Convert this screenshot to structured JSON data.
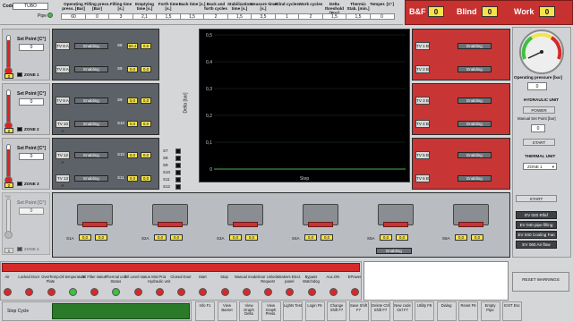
{
  "header": {
    "code_label": "Code",
    "code_value": "TUBO",
    "pipe_label": "Pipe",
    "fields": [
      {
        "label": "Operating press. [Bar]",
        "value": "60"
      },
      {
        "label": "Filling press. [Bar]",
        "value": "0"
      },
      {
        "label": "Filling time [s.]",
        "value": "3"
      },
      {
        "label": "Emptying time [s.]",
        "value": "2,1"
      },
      {
        "label": "Forth time [s.]",
        "value": "1,5"
      },
      {
        "label": "Back time [s.]",
        "value": "1,5"
      },
      {
        "label": "Back and forth cycles",
        "value": "2"
      },
      {
        "label": "Stabilization time [s.]",
        "value": "1,5"
      },
      {
        "label": "Measure time [s.]",
        "value": "3,5"
      },
      {
        "label": "Blind cycles",
        "value": "1"
      },
      {
        "label": "Work cycles",
        "value": "2"
      },
      {
        "label": "Delta threshold [Bar]",
        "value": "1,5"
      },
      {
        "label": "Thermic Stab. [min.]",
        "value": "1,5"
      },
      {
        "label": "Temper. [C°]",
        "value": "0"
      }
    ],
    "counters": [
      {
        "label": "B&F",
        "value": "0"
      },
      {
        "label": "Blind",
        "value": "0"
      },
      {
        "label": "Work",
        "value": "0"
      }
    ]
  },
  "zones": [
    {
      "label": "ZONE 1",
      "setpoint_label": "Set Point [C°]",
      "setpoint": "0",
      "readout": "0"
    },
    {
      "label": "ZONE 2",
      "setpoint_label": "Set Point [C°]",
      "setpoint": "0",
      "readout": "0"
    },
    {
      "label": "ZONE 3",
      "setpoint_label": "Set Point [C°]",
      "setpoint": "0",
      "readout": "0"
    },
    {
      "label": "ZONE 4",
      "setpoint_label": "Set Point [C°]",
      "setpoint": "0",
      "readout": "0"
    }
  ],
  "thermo_top_label": "T60",
  "left_panels": [
    {
      "tv_a": "TV 8 A",
      "tv_b": "TV 8 A",
      "s_a": "S8",
      "s_b": "S9",
      "val_a1": "60,4",
      "val_a2": "0,0",
      "val_b1": "0,0",
      "val_b2": "0,0",
      "enabling": "Enabling"
    },
    {
      "tv_a": "TV 9 A",
      "tv_b": "TV 10 A",
      "s_a": "S9",
      "s_b": "S10",
      "val_a1": "0,0",
      "val_a2": "0,0",
      "val_b1": "0,0",
      "val_b2": "0,0",
      "enabling": "Enabling"
    },
    {
      "tv_a": "TV 12 A",
      "tv_b": "TV 13 A",
      "s_a": "S10",
      "s_b": "S11",
      "val_a1": "0,0",
      "val_a2": "0,0",
      "val_b1": "0,0",
      "val_b2": "0,0",
      "enabling": "Enabling"
    }
  ],
  "right_panels": [
    {
      "tv_a": "TV 1 B",
      "tv_b": "TV 2 B",
      "enabling": "Enabling"
    },
    {
      "tv_a": "TV 3 B",
      "tv_b": "TV 4 B",
      "enabling": "Enabling"
    },
    {
      "tv_a": "TV 5 B",
      "tv_b": "TV 6 B",
      "enabling": "Enabling"
    }
  ],
  "sensor_list": [
    "S7",
    "S8",
    "S9",
    "S10",
    "S11",
    "S12"
  ],
  "chart": {
    "ylabel": "Delta [bar]",
    "xlabel": "Step",
    "yticks": [
      "0,5",
      "0,4",
      "0,3",
      "0,2",
      "0,1",
      "0"
    ]
  },
  "bottom_panel": {
    "stations": [
      "S1A",
      "S2A",
      "S3A",
      "S4A",
      "S5A",
      "S6A"
    ],
    "values": [
      "0,0",
      "0,0",
      "0,0",
      "0,0",
      "0,0",
      "0,0"
    ],
    "enabling": "Enabling"
  },
  "right_sidebar": {
    "gauge_label": "Operating pressure [bar]",
    "gauge_value": "0",
    "hydraulic_title": "HYDRAULIC UNIT",
    "power_label": "POWER",
    "manual_sp_label": "Manual Set Point [bar]",
    "manual_sp_value": "0",
    "start_label": "START",
    "thermal_title": "THERMAL UNIT",
    "zone_select": "ZONE 1",
    "start2_label": "START",
    "ev_buttons": [
      "EV 020 Rifaf",
      "EV 040 pipe filling",
      "EV 040 Cooling Fan",
      "EV 060 Air flow"
    ]
  },
  "alarms": [
    {
      "label": "Air",
      "color": "red"
    },
    {
      "label": "Locked Door",
      "color": "red"
    },
    {
      "label": "OverTemp. Plate",
      "color": "red"
    },
    {
      "label": "Oil temperature",
      "color": "green"
    },
    {
      "label": "Oil Filter status",
      "color": "red"
    },
    {
      "label": "Thermal unit Status",
      "color": "green"
    },
    {
      "label": "Oil Level status",
      "color": "red"
    },
    {
      "label": "Mot.Prot. Hydraulic unit",
      "color": "red"
    },
    {
      "label": "Closed Door",
      "color": "red"
    },
    {
      "label": "Start",
      "color": "red"
    },
    {
      "label": "Stop",
      "color": "red"
    },
    {
      "label": "Manual mode",
      "color": "red"
    },
    {
      "label": "Door Unlock Request",
      "color": "red"
    },
    {
      "label": "Brakers Elect. panel",
      "color": "red"
    },
    {
      "label": "Bypass Watchdog",
      "color": "red"
    },
    {
      "label": "Aux.ON",
      "color": "red"
    },
    {
      "label": "EPower",
      "color": "red"
    }
  ],
  "reset_warnings": "RESET WARNINGS",
  "stop_cycle": "Stop Cycle",
  "toolbar": [
    {
      "label": "Info F1"
    },
    {
      "label": "View Barnet"
    },
    {
      "label": "View Graph Delta"
    },
    {
      "label": "View Graph Press."
    },
    {
      "label": "Lights Test"
    },
    {
      "label": "Login F6"
    },
    {
      "label": "Change Shift F7"
    },
    {
      "label": "Save Shift F7"
    },
    {
      "label": "Delete Ctrl Shift F7"
    },
    {
      "label": "New code Ctrl F7"
    },
    {
      "label": "Utility F8"
    },
    {
      "label": "Dialog"
    },
    {
      "label": "Reset F9"
    },
    {
      "label": "Empty Pipe"
    },
    {
      "label": "EXIT Esc"
    }
  ]
}
